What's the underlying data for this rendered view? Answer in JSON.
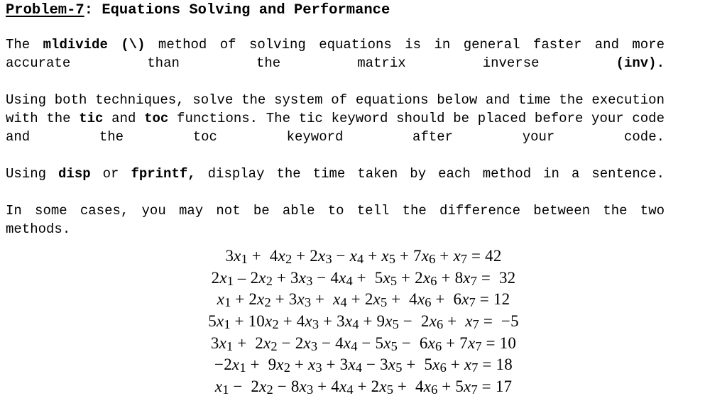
{
  "document": {
    "title_underlined": "Problem-7",
    "title_rest": ": Equations Solving and Performance",
    "paragraphs": [
      {
        "id": "para-mldivide",
        "runs": [
          {
            "t": "The ",
            "b": false
          },
          {
            "t": "mldivide",
            "b": true
          },
          {
            "t": " ",
            "b": false
          },
          {
            "t": "(\\)",
            "b": true
          },
          {
            "t": " method of solving equations is in general faster and more accurate than the matrix inverse ",
            "b": false
          },
          {
            "t": "(inv)",
            "b": true
          },
          {
            "t": ".",
            "b": true
          }
        ]
      },
      {
        "id": "para-tictoc",
        "runs": [
          {
            "t": "Using both techniques, solve the system of equations below and time the execution with the ",
            "b": false
          },
          {
            "t": "tic",
            "b": true
          },
          {
            "t": " and ",
            "b": false
          },
          {
            "t": "toc",
            "b": true
          },
          {
            "t": " functions. The tic keyword should be placed before your code and the toc keyword after your code.",
            "b": false
          }
        ]
      },
      {
        "id": "para-disp",
        "runs": [
          {
            "t": "Using ",
            "b": false
          },
          {
            "t": "disp",
            "b": true
          },
          {
            "t": " or ",
            "b": false
          },
          {
            "t": "fprintf,",
            "b": true
          },
          {
            "t": " display the time taken by each method in a sentence.",
            "b": false
          }
        ]
      },
      {
        "id": "para-difference",
        "runs": [
          {
            "t": "In some cases, you may not be able to tell the difference between the two methods.",
            "b": false
          }
        ]
      }
    ],
    "equations": [
      {
        "terms": [
          {
            "coef": "3",
            "var": "x",
            "sub": "1"
          },
          {
            "op": "+",
            "coef": "4",
            "var": "x",
            "sub": "2",
            "gap": true
          },
          {
            "op": "+",
            "coef": "2",
            "var": "x",
            "sub": "3"
          },
          {
            "op": "−",
            "coef": "",
            "var": "x",
            "sub": "4"
          },
          {
            "op": "+",
            "coef": "",
            "var": "x",
            "sub": "5"
          },
          {
            "op": "+",
            "coef": "7",
            "var": "x",
            "sub": "6"
          },
          {
            "op": "+",
            "coef": "",
            "var": "x",
            "sub": "7"
          }
        ],
        "rhs": "42",
        "rhs_gap": false
      },
      {
        "terms": [
          {
            "coef": "2",
            "var": "x",
            "sub": "1"
          },
          {
            "op": "–",
            "coef": "2",
            "var": "x",
            "sub": "2"
          },
          {
            "op": "+",
            "coef": "3",
            "var": "x",
            "sub": "3"
          },
          {
            "op": "−",
            "coef": "4",
            "var": "x",
            "sub": "4"
          },
          {
            "op": "+",
            "coef": "5",
            "var": "x",
            "sub": "5",
            "gap": true
          },
          {
            "op": "+",
            "coef": "2",
            "var": "x",
            "sub": "6"
          },
          {
            "op": "+",
            "coef": "8",
            "var": "x",
            "sub": "7"
          }
        ],
        "rhs": "32",
        "rhs_gap": true
      },
      {
        "terms": [
          {
            "coef": "",
            "var": "x",
            "sub": "1"
          },
          {
            "op": "+",
            "coef": "2",
            "var": "x",
            "sub": "2"
          },
          {
            "op": "+",
            "coef": "3",
            "var": "x",
            "sub": "3"
          },
          {
            "op": "+",
            "coef": "",
            "var": "x",
            "sub": "4",
            "gap": true
          },
          {
            "op": "+",
            "coef": "2",
            "var": "x",
            "sub": "5"
          },
          {
            "op": "+",
            "coef": "4",
            "var": "x",
            "sub": "6",
            "gap": true
          },
          {
            "op": "+",
            "coef": "6",
            "var": "x",
            "sub": "7",
            "gap": true
          }
        ],
        "rhs": "12",
        "rhs_gap": false
      },
      {
        "terms": [
          {
            "coef": "5",
            "var": "x",
            "sub": "1"
          },
          {
            "op": "+",
            "coef": "10",
            "var": "x",
            "sub": "2"
          },
          {
            "op": "+",
            "coef": "4",
            "var": "x",
            "sub": "3"
          },
          {
            "op": "+",
            "coef": "3",
            "var": "x",
            "sub": "4"
          },
          {
            "op": "+",
            "coef": "9",
            "var": "x",
            "sub": "5"
          },
          {
            "op": "−",
            "coef": "2",
            "var": "x",
            "sub": "6",
            "gap": true
          },
          {
            "op": "+",
            "coef": "",
            "var": "x",
            "sub": "7",
            "gap": true
          }
        ],
        "rhs": "−5",
        "rhs_gap": true
      },
      {
        "terms": [
          {
            "coef": "3",
            "var": "x",
            "sub": "1"
          },
          {
            "op": "+",
            "coef": "2",
            "var": "x",
            "sub": "2",
            "gap": true
          },
          {
            "op": "−",
            "coef": "2",
            "var": "x",
            "sub": "3"
          },
          {
            "op": "−",
            "coef": "4",
            "var": "x",
            "sub": "4"
          },
          {
            "op": "−",
            "coef": "5",
            "var": "x",
            "sub": "5"
          },
          {
            "op": "−",
            "coef": "6",
            "var": "x",
            "sub": "6",
            "gap": true
          },
          {
            "op": "+",
            "coef": "7",
            "var": "x",
            "sub": "7"
          }
        ],
        "rhs": "10",
        "rhs_gap": false
      },
      {
        "terms": [
          {
            "coef": "−2",
            "var": "x",
            "sub": "1"
          },
          {
            "op": "+",
            "coef": "9",
            "var": "x",
            "sub": "2",
            "gap": true
          },
          {
            "op": "+",
            "coef": "",
            "var": "x",
            "sub": "3"
          },
          {
            "op": "+",
            "coef": "3",
            "var": "x",
            "sub": "4"
          },
          {
            "op": "−",
            "coef": "3",
            "var": "x",
            "sub": "5"
          },
          {
            "op": "+",
            "coef": "5",
            "var": "x",
            "sub": "6",
            "gap": true
          },
          {
            "op": "+",
            "coef": "",
            "var": "x",
            "sub": "7"
          }
        ],
        "rhs": "18",
        "rhs_gap": false
      },
      {
        "terms": [
          {
            "coef": "",
            "var": "x",
            "sub": "1"
          },
          {
            "op": "−",
            "coef": "2",
            "var": "x",
            "sub": "2",
            "gap": true
          },
          {
            "op": "−",
            "coef": "8",
            "var": "x",
            "sub": "3"
          },
          {
            "op": "+",
            "coef": "4",
            "var": "x",
            "sub": "4"
          },
          {
            "op": "+",
            "coef": "2",
            "var": "x",
            "sub": "5"
          },
          {
            "op": "+",
            "coef": "4",
            "var": "x",
            "sub": "6",
            "gap": true
          },
          {
            "op": "+",
            "coef": "5",
            "var": "x",
            "sub": "7"
          }
        ],
        "rhs": "17",
        "rhs_gap": false
      }
    ],
    "equations_plain": [
      "3x1 + 4x2 + 2x3 − x4 + x5 + 7x6 + x7 = 42",
      "2x1 – 2x2 + 3x3 − 4x4 + 5x5 + 2x6 + 8x7 = 32",
      "x1 + 2x2 + 3x3 + x4 + 2x5 + 4x6 + 6x7 = 12",
      "5x1 + 10x2 + 4x3 + 3x4 + 9x5 − 2x6 + x7 = −5",
      "3x1 + 2x2 − 2x3 − 4x4 − 5x5 − 6x6 + 7x7 = 10",
      "−2x1 + 9x2 + x3 + 3x4 − 3x5 + 5x6 + x7 = 18",
      "x1 − 2x2 − 8x3 + 4x4 + 2x5 + 4x6 + 5x7 = 17"
    ],
    "colors": {
      "text": "#000000",
      "background": "#ffffff"
    }
  }
}
